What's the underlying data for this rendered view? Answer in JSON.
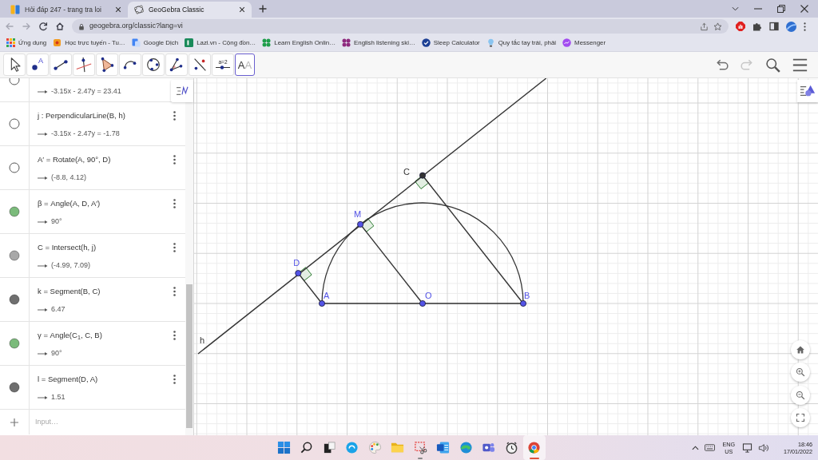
{
  "browser": {
    "tabs": [
      {
        "kind": "hoidap",
        "title": "Hỏi đáp 247 - trang tra loi",
        "selected": false
      },
      {
        "kind": "geogebra",
        "title": "GeoGebra Classic",
        "selected": true
      }
    ],
    "nav": [
      {
        "kind": "back",
        "disabled": true
      },
      {
        "kind": "forward",
        "disabled": true
      },
      {
        "kind": "reload",
        "disabled": false
      },
      {
        "kind": "home",
        "disabled": false
      }
    ],
    "url": "geogebra.org/classic?lang=vi",
    "bookmarks": [
      {
        "kind": "apps",
        "title": "Ứng dụng"
      },
      {
        "kind": "tile",
        "title": "Học trực tuyến - Tu…"
      },
      {
        "kind": "document",
        "title": "Google Dịch"
      },
      {
        "kind": "square",
        "title": "Lazi.vn - Cộng đồn…"
      },
      {
        "kind": "dots",
        "color": "#1e9e4a",
        "title": "Learn English Onlin…"
      },
      {
        "kind": "dots",
        "color": "#8e2a7e",
        "title": "English listening ski…"
      },
      {
        "kind": "check",
        "title": "Sleep Calculator"
      },
      {
        "kind": "bulb",
        "title": "Quy tắc tay trái, phải"
      },
      {
        "kind": "bubble",
        "title": "Messenger"
      }
    ]
  },
  "toolbar": {
    "tools": [
      {
        "kind": "move",
        "selected": false
      },
      {
        "kind": "point",
        "text": "A",
        "selected": false
      },
      {
        "kind": "segment",
        "selected": false
      },
      {
        "kind": "perpendicular",
        "selected": false
      },
      {
        "kind": "polygon",
        "selected": false
      },
      {
        "kind": "arc",
        "selected": false
      },
      {
        "kind": "circle",
        "selected": false
      },
      {
        "kind": "angle",
        "selected": false
      },
      {
        "kind": "reflect",
        "selected": false
      },
      {
        "kind": "slider",
        "text": "a=2",
        "selected": false
      },
      {
        "kind": "text",
        "text": "AA",
        "selected": true
      }
    ],
    "actions": [
      {
        "kind": "undo",
        "disabled": false
      },
      {
        "kind": "redo",
        "disabled": true
      },
      {
        "kind": "search"
      },
      {
        "kind": "menu"
      }
    ]
  },
  "algebra": {
    "rows": [
      {
        "kind": "clipped",
        "visible": false,
        "value": "-3.15x - 2.47y = 23.41"
      },
      {
        "kind": "entry",
        "visible": false,
        "definition": "j : PerpendicularLine(B, h)",
        "value": "-3.15x - 2.47y = -1.78"
      },
      {
        "kind": "entry",
        "visible": false,
        "definition": "A′ = Rotate(A, 90°, D)",
        "value": "(-8.8, 4.12)"
      },
      {
        "kind": "entry",
        "visible": true,
        "color": "#7bbb7b",
        "definition": "β = Angle(A, D, A′)",
        "value": "90°"
      },
      {
        "kind": "entry",
        "visible": true,
        "color": "#a8a8a8",
        "definition": "C = Intersect(h, j)",
        "value": "(-4.99, 7.09)"
      },
      {
        "kind": "entry",
        "visible": true,
        "color": "#6f6f6f",
        "definition": "k = Segment(B, C)",
        "value": "6.47"
      },
      {
        "kind": "entry",
        "visible": true,
        "color": "#7bbb7b",
        "definition": "γ = Angle(C$_{1}$, C, B)",
        "value": "90°"
      },
      {
        "kind": "entry",
        "visible": true,
        "color": "#6f6f6f",
        "definition": "l = Segment(D, A)",
        "value": "1.51"
      }
    ],
    "input": {
      "placeholder": "Input…"
    }
  },
  "graphics": {
    "line_label": "h",
    "points": [
      {
        "label": "C",
        "color": "#333333"
      },
      {
        "label": "M",
        "color": "#5353e6"
      },
      {
        "label": "D",
        "color": "#5353e6"
      },
      {
        "label": "A",
        "color": "#5353e6"
      },
      {
        "label": "O",
        "color": "#5353e6"
      },
      {
        "label": "B",
        "color": "#5353e6"
      }
    ]
  },
  "taskbar": {
    "apps": [
      {
        "kind": "start",
        "running": false,
        "active": false
      },
      {
        "kind": "search",
        "running": false,
        "active": false
      },
      {
        "kind": "taskview",
        "running": false,
        "active": false
      },
      {
        "kind": "skype",
        "running": false,
        "active": false
      },
      {
        "kind": "paint",
        "running": false,
        "active": false
      },
      {
        "kind": "folder",
        "running": false,
        "active": false
      },
      {
        "kind": "snip",
        "running": true,
        "active": false
      },
      {
        "kind": "word",
        "running": false,
        "active": false
      },
      {
        "kind": "edge",
        "running": false,
        "active": false
      },
      {
        "kind": "teams",
        "running": false,
        "active": false
      },
      {
        "kind": "clock",
        "running": false,
        "active": false
      },
      {
        "kind": "chrome",
        "running": true,
        "active": true
      }
    ],
    "language": "ENG",
    "region": "US",
    "time": "18:46",
    "date": "17/01/2022"
  }
}
